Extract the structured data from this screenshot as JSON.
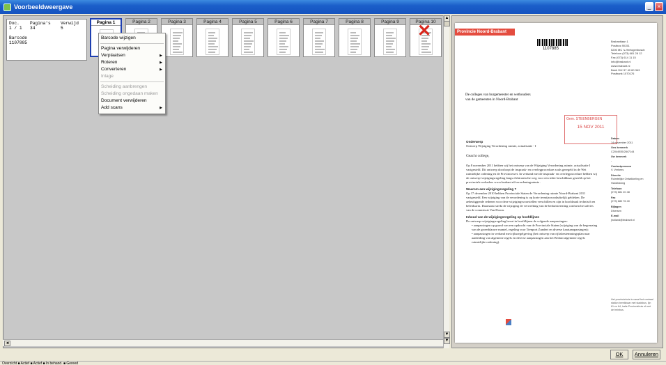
{
  "window": {
    "title": "Voorbeeldweergave",
    "buttons": [
      "_",
      "×"
    ]
  },
  "info": {
    "headers": [
      "Doc.",
      "Pagina's",
      "Verwijd"
    ],
    "values": [
      "1 / 1",
      "34",
      "5"
    ],
    "barcode_label": "Barcode",
    "barcode_value": "1107885"
  },
  "thumbnails": [
    {
      "label": "Pagina 1",
      "selected": true
    },
    {
      "label": "Pagina 2"
    },
    {
      "label": "Pagina 3"
    },
    {
      "label": "Pagina 4"
    },
    {
      "label": "Pagina 5"
    },
    {
      "label": "Pagina 6"
    },
    {
      "label": "Pagina 7"
    },
    {
      "label": "Pagina 8"
    },
    {
      "label": "Pagina 9"
    },
    {
      "label": "Pagina 10",
      "deleted": true
    }
  ],
  "context_menu": {
    "items": [
      {
        "label": "Barcode wijzigen"
      },
      {
        "sep": true
      },
      {
        "label": "Pagina verwijderen"
      },
      {
        "label": "Verplaatsen",
        "submenu": true
      },
      {
        "label": "Roteren",
        "submenu": true
      },
      {
        "label": "Converteren",
        "submenu": true
      },
      {
        "label": "Inlage",
        "disabled": true
      },
      {
        "sep": true
      },
      {
        "label": "Scheiding aanbrengen",
        "disabled": true
      },
      {
        "label": "Scheiding ongedaan maken",
        "disabled": true
      },
      {
        "label": "Document verwijderen"
      },
      {
        "label": "Add scans",
        "submenu": true
      }
    ]
  },
  "preview": {
    "banner": "Provincie Noord-Brabant",
    "barcode": "1107885",
    "sender": [
      "Brabantlaan 1",
      "Postbus 90151",
      "5200 MC  's-Hertogenbosch",
      "Telefoon (073) 681 28 12",
      "Fax (073) 614 11 15",
      "info@brabant.nl",
      "www.brabant.nl",
      "Bank 9ĽĽ 57 40 60 343",
      "Postbank 1070176"
    ],
    "address": [
      "De colleges van burgemeester en wethouders",
      "van de gemeenten in Noord-Brabant"
    ],
    "stamp_top": "Gem. STEENBERGEN",
    "stamp_date": "15 NOV 2011",
    "subject_label": "Onderwerp",
    "subject": "Ontwerp Wijziging Verordening ruimte, actualisatie - I",
    "greeting": "Geacht college,",
    "p1": "Op 8 november 2011 hebben wij het ontwerp van de Wijziging Verordening ruimte, actualisatie I vastgesteld. Dit ontwerp doorloopt de inspraak- en overlegprocedure zoals geregeld in de Wet ruimtelijke ordening en de Provinciewet. In verband met de inspraak- en overlegprocedure hebben wij de ontwerp-wijzigingsregeling langs elektronische weg voor een ieder beschikbaar gesteld op het provinciale webadres www.brabant.nl/verordeningruimte .",
    "h2": "Waarom een wijzigingsregeling ?",
    "p2": "Op 17 december 2010 hebben Provinciale Staten de Verordening ruimte Noord-Brabant 2011 vastgesteld. Een wijziging van de verordening is op korte termijn noodzakelijk gebleken. De aebestiggende redenen voor deze wijzigingsvoorstellen verschillen en zijn in hoofdzaak technisch en beleidsarm. Daarnaast strekt de wijziging de verwerking van de bedaristeerning conform het advies van de commissie Van Doorn.",
    "h3": "Inhoud van de wijzigingsregeling op hoofdlijnen",
    "p3": "De ontwerp-wijzigingsregeling bevat in hoofdlijnen de volgende aanpassingen:",
    "bullets": [
      "aanpassingen op grond van een opdracht van de Provinciale Staten (wijziging van de begrenzing van de groenblauwe mantel, regeling voor Trenport Zundert en diverse kaartaanpassingen);",
      "aanpassingen in verband met rijksregelgeving (het ontwerp van rijksbestemmingsplan naar aanleiding van algemene regels en diverse aanpassingen aan het Besluit algemene regels ruimtelijke ordening)."
    ],
    "meta": [
      {
        "k": "Datum",
        "v": "14 november 2011"
      },
      {
        "k": "Ons kenmerk",
        "v": "C2044935/2847144"
      },
      {
        "k": "Uw kenmerk",
        "v": "-"
      },
      {
        "k": "Contactpersoon",
        "v": "V. Verhees"
      },
      {
        "k": "Directie",
        "v": "Ruimtelijke Ontwikkeling en Handhaving"
      },
      {
        "k": "Telefoon",
        "v": "(073) 681 20 48"
      },
      {
        "k": "Fax",
        "v": "(073) 680 76 40"
      },
      {
        "k": "Bijlagen",
        "v": "Diversen"
      },
      {
        "k": "E-mail",
        "v": "jholland@brabant.nl"
      }
    ],
    "footnote": "Het provinciehuis is vanaf het centraal station bereikbaar met stadsbus, lijn 61 en 64, halte Provinciehuis of met de treinbus."
  },
  "footer": {
    "ok": "OK",
    "cancel": "Annuleren"
  },
  "statusbar": {
    "text": "Overzicht  ■ Actief  ■ Actief  ■ In behand.  ■ Gereed"
  }
}
